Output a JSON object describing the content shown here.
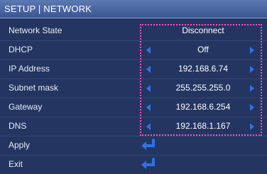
{
  "window": {
    "title": "SETUP | NETWORK"
  },
  "rows": [
    {
      "label": "Network State",
      "value": "Disconnect"
    },
    {
      "label": "DHCP",
      "value": "Off"
    },
    {
      "label": "IP Address",
      "value": "192.168.6.74"
    },
    {
      "label": "Subnet mask",
      "value": "255.255.255.0"
    },
    {
      "label": "Gateway",
      "value": "192.168.6.254"
    },
    {
      "label": "DNS",
      "value": "192.168.1.167"
    },
    {
      "label": "Apply"
    },
    {
      "label": "Exit"
    }
  ],
  "colors": {
    "background": "#243561",
    "titlebar": "#4a66a3",
    "arrow": "#2d72e6",
    "highlight_border": "#ff4fc0"
  },
  "icons": {
    "decrease": "arrow-left-icon",
    "increase": "arrow-right-icon",
    "confirm": "enter-icon"
  }
}
